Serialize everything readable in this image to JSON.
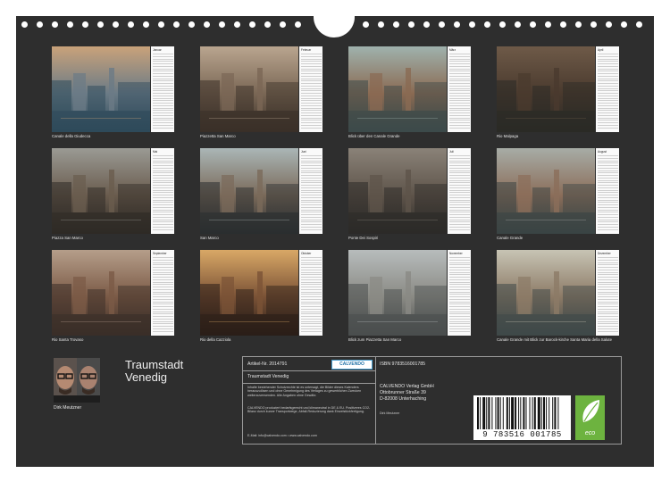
{
  "months": [
    {
      "name": "Januar",
      "caption": "Canale della Giudecca"
    },
    {
      "name": "Februar",
      "caption": "Piazzetta San Marco"
    },
    {
      "name": "März",
      "caption": "Blick über den Canale Grande"
    },
    {
      "name": "April",
      "caption": "Rio Malpaga"
    },
    {
      "name": "Mai",
      "caption": "Piazza San Marco"
    },
    {
      "name": "Juni",
      "caption": "San Marco"
    },
    {
      "name": "Juli",
      "caption": "Ponte Dei Sospiri"
    },
    {
      "name": "August",
      "caption": "Canale Grande"
    },
    {
      "name": "September",
      "caption": "Rio Santa Trovaso"
    },
    {
      "name": "Oktober",
      "caption": "Rio della Cazziola"
    },
    {
      "name": "November",
      "caption": "Blick zum Piazzetta San Marco"
    },
    {
      "name": "Dezember",
      "caption": "Canale Grande mit Blick zur Barock-kirche Santa Maria della Salute"
    }
  ],
  "author": {
    "name": "Dirk Meutzner"
  },
  "title": {
    "line1": "Traumstadt",
    "line2": "Venedig"
  },
  "info": {
    "article": "Artikel-Nr. 2014791",
    "brand_badge": "CALVENDO",
    "product_title": "Traumstadt Venedig",
    "legal_text": "Inhalte bestehender Schutzrechte ist es untersagt, die Bilder dieses Kalenders herauszulösen und ohne Genehmigung des Verlages zu gewerblichen Zwecken weiterzuverwenden. Alle Angaben ohne Gewähr.",
    "production_text": "CALVENDO produziert bedarfsgerecht und klimaneutral in DE & EU. Positiveres CO2-Bilanz durch kurzer Transportwege, Abfall-Reduzierung dank Einzelstückfertigung.",
    "contact": "E-Mail: info@calvendo.com • www.calvendo.com",
    "isbn": "ISBN 9783516001785",
    "publisher_line1": "CALVENDO Verlag GmbH",
    "publisher_line2": "Ottobrunner Straße 39",
    "publisher_line3": "D-82008 Unterhaching",
    "author_short": "Dirk Meutzner",
    "barcode_digits": "9 783516 001785",
    "eco_label": "eco"
  },
  "colors": {
    "sheet": "#2e2e2e",
    "eco_green": "#6db33f",
    "badge_blue": "#1d6fa5"
  }
}
